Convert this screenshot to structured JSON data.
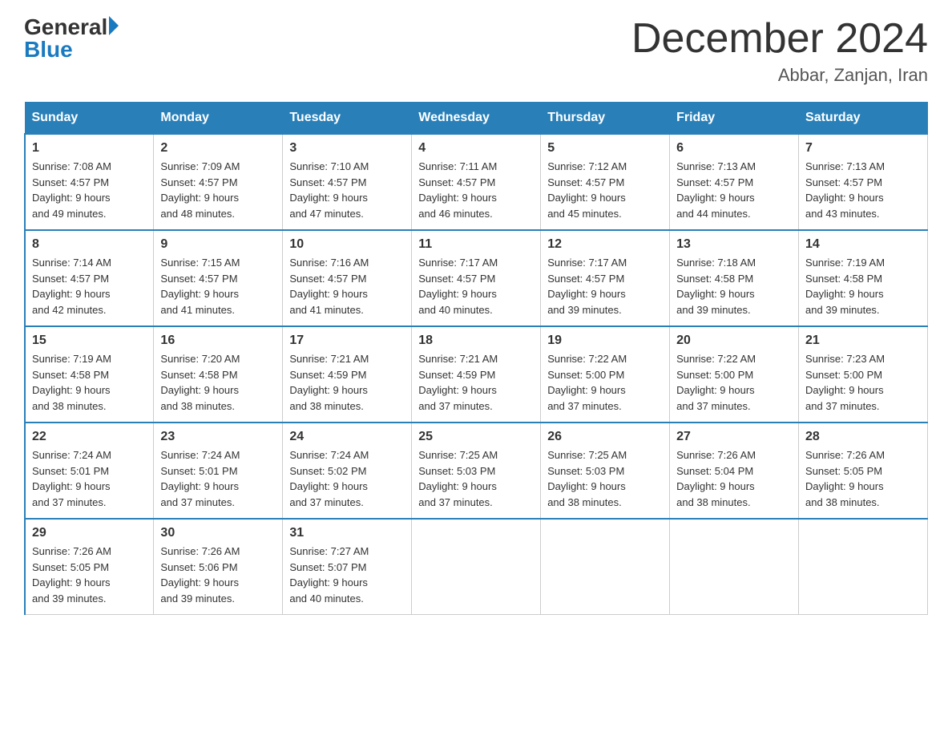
{
  "header": {
    "logo_general": "General",
    "logo_blue": "Blue",
    "month_title": "December 2024",
    "location": "Abbar, Zanjan, Iran"
  },
  "days_of_week": [
    "Sunday",
    "Monday",
    "Tuesday",
    "Wednesday",
    "Thursday",
    "Friday",
    "Saturday"
  ],
  "weeks": [
    [
      {
        "day": "1",
        "sunrise": "7:08 AM",
        "sunset": "4:57 PM",
        "daylight": "9 hours and 49 minutes."
      },
      {
        "day": "2",
        "sunrise": "7:09 AM",
        "sunset": "4:57 PM",
        "daylight": "9 hours and 48 minutes."
      },
      {
        "day": "3",
        "sunrise": "7:10 AM",
        "sunset": "4:57 PM",
        "daylight": "9 hours and 47 minutes."
      },
      {
        "day": "4",
        "sunrise": "7:11 AM",
        "sunset": "4:57 PM",
        "daylight": "9 hours and 46 minutes."
      },
      {
        "day": "5",
        "sunrise": "7:12 AM",
        "sunset": "4:57 PM",
        "daylight": "9 hours and 45 minutes."
      },
      {
        "day": "6",
        "sunrise": "7:13 AM",
        "sunset": "4:57 PM",
        "daylight": "9 hours and 44 minutes."
      },
      {
        "day": "7",
        "sunrise": "7:13 AM",
        "sunset": "4:57 PM",
        "daylight": "9 hours and 43 minutes."
      }
    ],
    [
      {
        "day": "8",
        "sunrise": "7:14 AM",
        "sunset": "4:57 PM",
        "daylight": "9 hours and 42 minutes."
      },
      {
        "day": "9",
        "sunrise": "7:15 AM",
        "sunset": "4:57 PM",
        "daylight": "9 hours and 41 minutes."
      },
      {
        "day": "10",
        "sunrise": "7:16 AM",
        "sunset": "4:57 PM",
        "daylight": "9 hours and 41 minutes."
      },
      {
        "day": "11",
        "sunrise": "7:17 AM",
        "sunset": "4:57 PM",
        "daylight": "9 hours and 40 minutes."
      },
      {
        "day": "12",
        "sunrise": "7:17 AM",
        "sunset": "4:57 PM",
        "daylight": "9 hours and 39 minutes."
      },
      {
        "day": "13",
        "sunrise": "7:18 AM",
        "sunset": "4:58 PM",
        "daylight": "9 hours and 39 minutes."
      },
      {
        "day": "14",
        "sunrise": "7:19 AM",
        "sunset": "4:58 PM",
        "daylight": "9 hours and 39 minutes."
      }
    ],
    [
      {
        "day": "15",
        "sunrise": "7:19 AM",
        "sunset": "4:58 PM",
        "daylight": "9 hours and 38 minutes."
      },
      {
        "day": "16",
        "sunrise": "7:20 AM",
        "sunset": "4:58 PM",
        "daylight": "9 hours and 38 minutes."
      },
      {
        "day": "17",
        "sunrise": "7:21 AM",
        "sunset": "4:59 PM",
        "daylight": "9 hours and 38 minutes."
      },
      {
        "day": "18",
        "sunrise": "7:21 AM",
        "sunset": "4:59 PM",
        "daylight": "9 hours and 37 minutes."
      },
      {
        "day": "19",
        "sunrise": "7:22 AM",
        "sunset": "5:00 PM",
        "daylight": "9 hours and 37 minutes."
      },
      {
        "day": "20",
        "sunrise": "7:22 AM",
        "sunset": "5:00 PM",
        "daylight": "9 hours and 37 minutes."
      },
      {
        "day": "21",
        "sunrise": "7:23 AM",
        "sunset": "5:00 PM",
        "daylight": "9 hours and 37 minutes."
      }
    ],
    [
      {
        "day": "22",
        "sunrise": "7:24 AM",
        "sunset": "5:01 PM",
        "daylight": "9 hours and 37 minutes."
      },
      {
        "day": "23",
        "sunrise": "7:24 AM",
        "sunset": "5:01 PM",
        "daylight": "9 hours and 37 minutes."
      },
      {
        "day": "24",
        "sunrise": "7:24 AM",
        "sunset": "5:02 PM",
        "daylight": "9 hours and 37 minutes."
      },
      {
        "day": "25",
        "sunrise": "7:25 AM",
        "sunset": "5:03 PM",
        "daylight": "9 hours and 37 minutes."
      },
      {
        "day": "26",
        "sunrise": "7:25 AM",
        "sunset": "5:03 PM",
        "daylight": "9 hours and 38 minutes."
      },
      {
        "day": "27",
        "sunrise": "7:26 AM",
        "sunset": "5:04 PM",
        "daylight": "9 hours and 38 minutes."
      },
      {
        "day": "28",
        "sunrise": "7:26 AM",
        "sunset": "5:05 PM",
        "daylight": "9 hours and 38 minutes."
      }
    ],
    [
      {
        "day": "29",
        "sunrise": "7:26 AM",
        "sunset": "5:05 PM",
        "daylight": "9 hours and 39 minutes."
      },
      {
        "day": "30",
        "sunrise": "7:26 AM",
        "sunset": "5:06 PM",
        "daylight": "9 hours and 39 minutes."
      },
      {
        "day": "31",
        "sunrise": "7:27 AM",
        "sunset": "5:07 PM",
        "daylight": "9 hours and 40 minutes."
      },
      null,
      null,
      null,
      null
    ]
  ]
}
